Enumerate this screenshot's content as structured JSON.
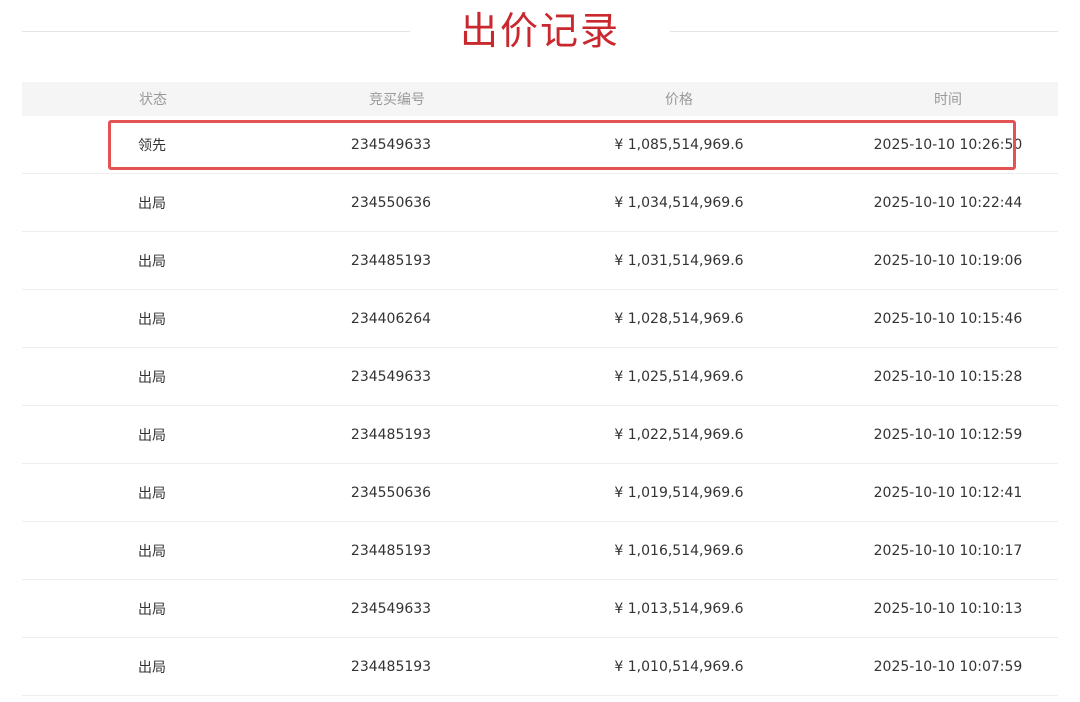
{
  "title": "出价记录",
  "columns": [
    "状态",
    "竞买编号",
    "价格",
    "时间"
  ],
  "rows": [
    {
      "status": "领先",
      "bid_id": "234549633",
      "price": "¥ 1,085,514,969.6",
      "time": "2025-10-10 10:26:50"
    },
    {
      "status": "出局",
      "bid_id": "234550636",
      "price": "¥ 1,034,514,969.6",
      "time": "2025-10-10 10:22:44"
    },
    {
      "status": "出局",
      "bid_id": "234485193",
      "price": "¥ 1,031,514,969.6",
      "time": "2025-10-10 10:19:06"
    },
    {
      "status": "出局",
      "bid_id": "234406264",
      "price": "¥ 1,028,514,969.6",
      "time": "2025-10-10 10:15:46"
    },
    {
      "status": "出局",
      "bid_id": "234549633",
      "price": "¥ 1,025,514,969.6",
      "time": "2025-10-10 10:15:28"
    },
    {
      "status": "出局",
      "bid_id": "234485193",
      "price": "¥ 1,022,514,969.6",
      "time": "2025-10-10 10:12:59"
    },
    {
      "status": "出局",
      "bid_id": "234550636",
      "price": "¥ 1,019,514,969.6",
      "time": "2025-10-10 10:12:41"
    },
    {
      "status": "出局",
      "bid_id": "234485193",
      "price": "¥ 1,016,514,969.6",
      "time": "2025-10-10 10:10:17"
    },
    {
      "status": "出局",
      "bid_id": "234549633",
      "price": "¥ 1,013,514,969.6",
      "time": "2025-10-10 10:10:13"
    },
    {
      "status": "出局",
      "bid_id": "234485193",
      "price": "¥ 1,010,514,969.6",
      "time": "2025-10-10 10:07:59"
    }
  ],
  "colors": {
    "title": "#c9282f",
    "highlight_border": "#e35353",
    "header_bg": "#f5f5f5"
  }
}
